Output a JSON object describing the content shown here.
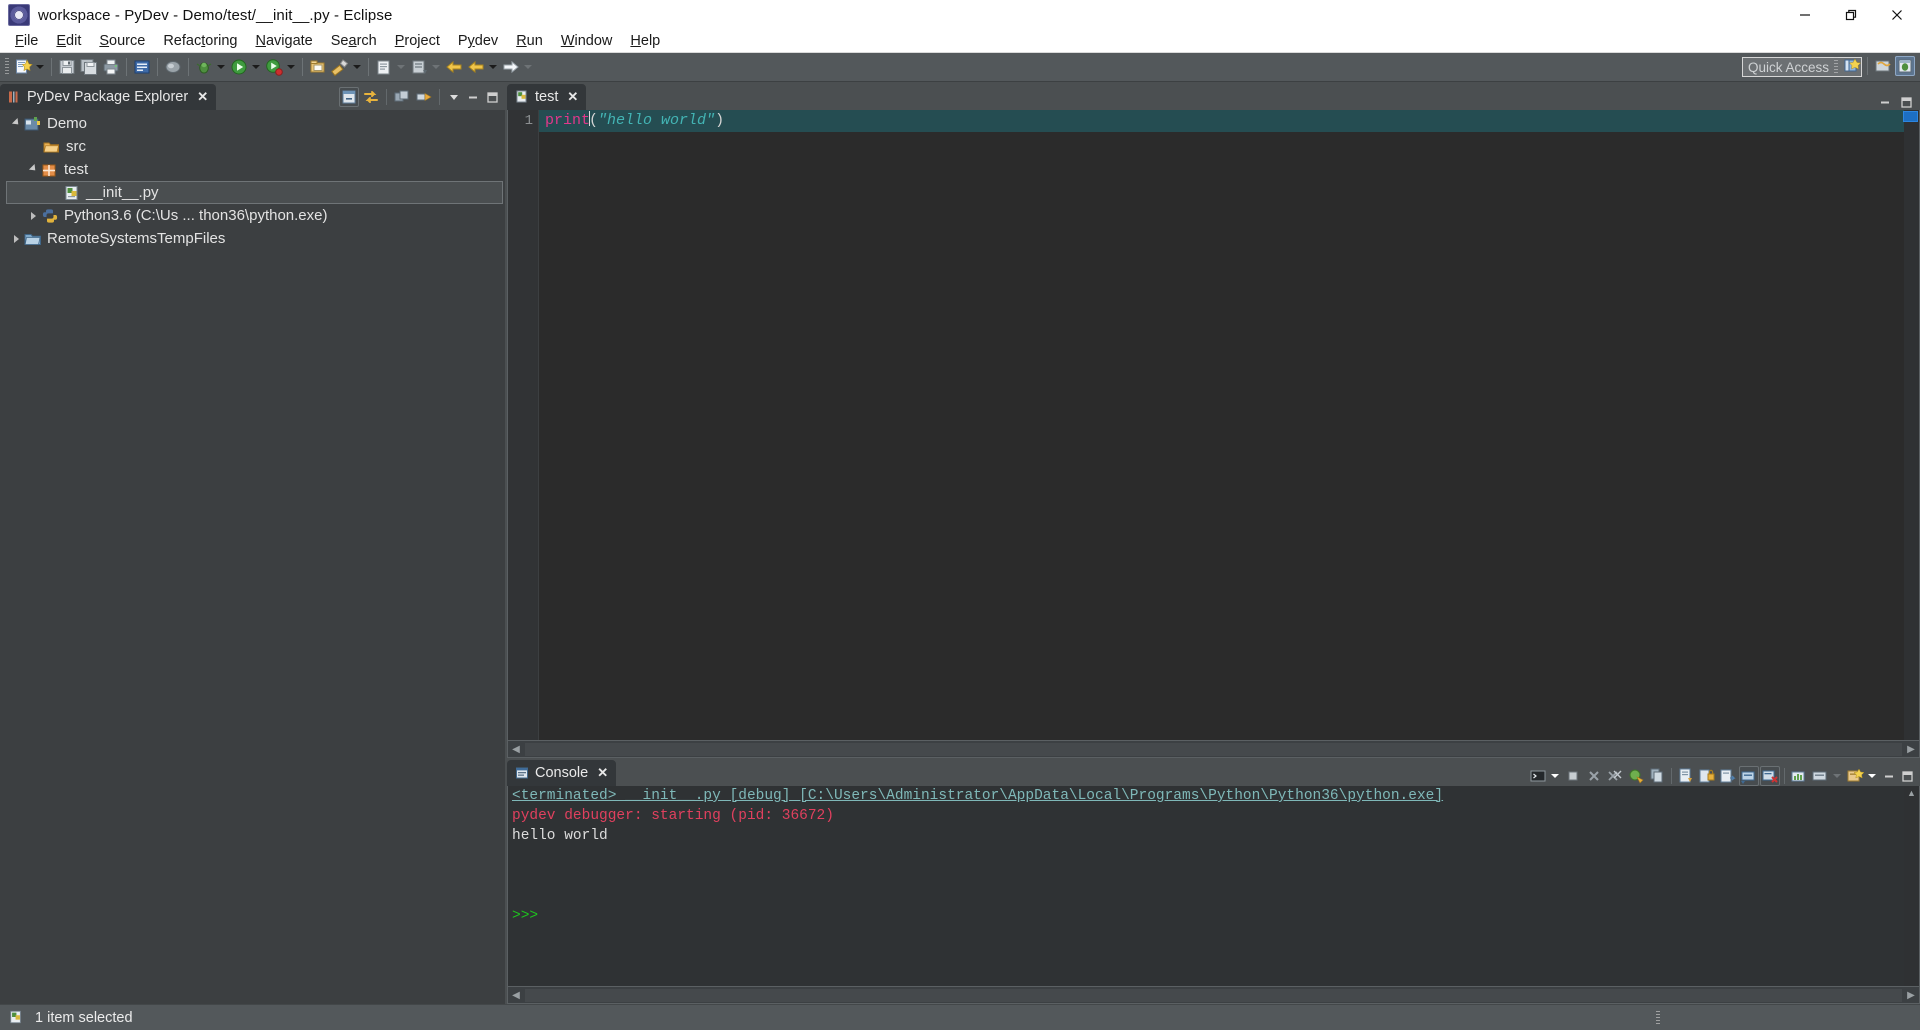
{
  "window": {
    "title": "workspace - PyDev - Demo/test/__init__.py - Eclipse",
    "app_icon": "eclipse-icon",
    "minimize_label": "Minimize",
    "restore_label": "Restore",
    "close_label": "Close"
  },
  "menu": {
    "items": [
      {
        "label": "File",
        "mnemonic": "F"
      },
      {
        "label": "Edit",
        "mnemonic": "E"
      },
      {
        "label": "Source",
        "mnemonic": "S"
      },
      {
        "label": "Refactoring",
        "mnemonic": "t"
      },
      {
        "label": "Navigate",
        "mnemonic": "N"
      },
      {
        "label": "Search",
        "mnemonic": "a"
      },
      {
        "label": "Project",
        "mnemonic": "P"
      },
      {
        "label": "Pydev",
        "mnemonic": "y"
      },
      {
        "label": "Run",
        "mnemonic": "R"
      },
      {
        "label": "Window",
        "mnemonic": "W"
      },
      {
        "label": "Help",
        "mnemonic": "H"
      }
    ]
  },
  "toolbar": {
    "quick_access_placeholder": "Quick Access",
    "buttons": [
      "new-wizard-icon",
      "save-icon",
      "save-all-icon",
      "print-icon",
      "new-python-module-icon",
      "debug-icon",
      "run-icon",
      "run-external-icon",
      "open-type-icon",
      "search-icon",
      "new-folder-icon",
      "refresh-icon",
      "back-icon",
      "forward-icon"
    ],
    "perspective_buttons": [
      "open-perspective-icon",
      "pydev-perspective-icon",
      "debug-perspective-icon"
    ]
  },
  "explorer": {
    "tab_label": "PyDev Package Explorer",
    "tab_icon": "package-explorer-icon",
    "close_icon": "close-icon",
    "toolbar_icons": [
      "collapse-all-icon",
      "link-with-editor-icon",
      "working-sets-icon",
      "focus-on-active-task-icon",
      "view-menu-icon",
      "minimize-icon",
      "maximize-icon"
    ],
    "tree": [
      {
        "label": "Demo",
        "icon": "pydev-project-icon",
        "indent": 0,
        "twisty": "open",
        "selected": false
      },
      {
        "label": "src",
        "icon": "folder-icon",
        "indent": 1,
        "twisty": "none",
        "selected": false
      },
      {
        "label": "test",
        "icon": "package-icon",
        "indent": 1,
        "twisty": "open",
        "selected": false
      },
      {
        "label": "__init__.py",
        "icon": "python-file-icon",
        "indent": 2,
        "twisty": "none",
        "selected": true
      },
      {
        "label": "Python3.6  (C:\\Us ... thon36\\python.exe)",
        "icon": "python-interpreter-icon",
        "indent": 1,
        "twisty": "closed",
        "selected": false
      },
      {
        "label": "RemoteSystemsTempFiles",
        "icon": "folder-project-icon",
        "indent": 0,
        "twisty": "closed",
        "selected": false
      }
    ]
  },
  "editor": {
    "tab_label": "test",
    "tab_icon": "python-file-icon",
    "close_icon": "close-icon",
    "minimize_icon": "minimize-icon",
    "maximize_icon": "maximize-icon",
    "line_number": "1",
    "code": {
      "function": "print",
      "open_paren": "(",
      "string": "\"hello world\"",
      "close_paren": ")"
    },
    "colors": {
      "background": "#2b2b2b",
      "current_line": "#254d52",
      "keyword": "#e2388b",
      "string": "#43b4b4",
      "gutter_text": "#8c8f91",
      "scroll_thumb": "#1d6fc4"
    }
  },
  "console": {
    "tab_label": "Console",
    "tab_icon": "console-icon",
    "close_icon": "close-icon",
    "toolbar_icons": [
      "new-console-icon",
      "dropdown-icon",
      "terminate-icon",
      "remove-launch-icon",
      "remove-all-terminated-icon",
      "toggle-console-icon",
      "copy-icon",
      "clear-console-icon",
      "scroll-lock-icon",
      "word-wrap-icon",
      "pin-console-icon",
      "display-selected-console-icon",
      "open-console-icon",
      "link-icon",
      "view-menu-icon",
      "minimize-icon",
      "maximize-icon"
    ],
    "lines": [
      {
        "text": "<terminated> __init__.py [debug] [C:\\Users\\Administrator\\AppData\\Local\\Programs\\Python\\Python36\\python.exe]",
        "style": "terminated"
      },
      {
        "text": "pydev debugger: starting (pid: 36672)",
        "style": "error"
      },
      {
        "text": "hello world",
        "style": "output"
      },
      {
        "text": "",
        "style": "output"
      },
      {
        "text": "",
        "style": "output"
      },
      {
        "text": ">>> ",
        "style": "prompt"
      }
    ],
    "colors": {
      "background": "#2f3234",
      "terminated_text": "#7fb8b8",
      "error_text": "#e0405e",
      "output_text": "#dcdcdc",
      "prompt_text": "#1ec21e"
    }
  },
  "statusbar": {
    "icon": "python-file-icon",
    "text": "1 item selected"
  }
}
